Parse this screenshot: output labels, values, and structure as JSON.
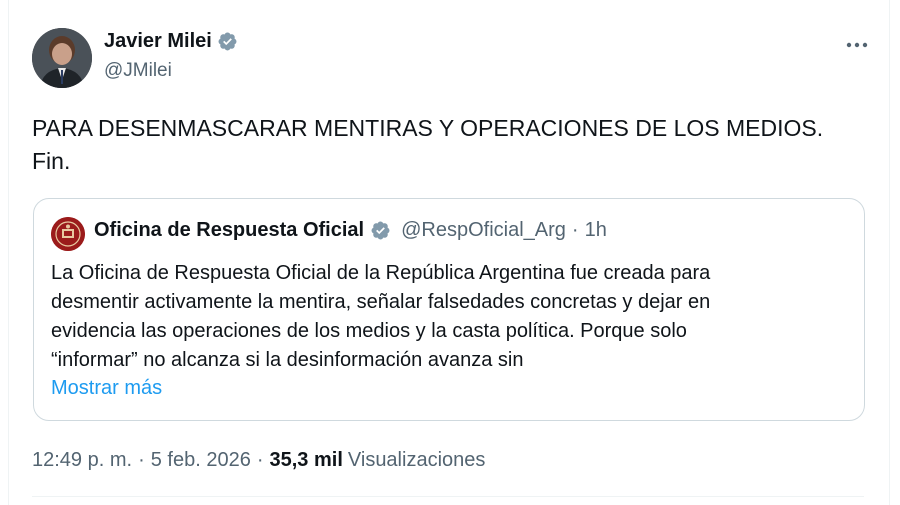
{
  "author": {
    "name": "Javier Milei",
    "handle": "@JMilei",
    "verified_icon": "verified-badge-icon",
    "avatar_icon": "profile-photo"
  },
  "more_icon": "more-options-icon",
  "tweet": {
    "line1": "PARA DESENMASCARAR MENTIRAS Y OPERACIONES DE LOS MEDIOS.",
    "line2": "Fin."
  },
  "quote": {
    "name": "Oficina de Respuesta Oficial",
    "handle": "@RespOficial_Arg",
    "separator": "·",
    "time": "1h",
    "lines": [
      "La Oficina de Respuesta Oficial de la República Argentina fue creada para",
      "desmentir activamente la mentira, señalar falsedades concretas y dejar en",
      "evidencia las operaciones de los medios y la casta política. Porque solo",
      "“informar” no alcanza si la desinformación avanza sin"
    ],
    "show_more": "Mostrar más"
  },
  "meta": {
    "time": "12:49 p. m.",
    "separator1": "·",
    "date": "5 feb. 2026",
    "separator2": "·",
    "views_count": "35,3 mil",
    "views_label": "Visualizaciones"
  },
  "colors": {
    "accent": "#1d9bf0",
    "verified": "#829aab",
    "secondary_text": "#536471",
    "border": "#cfd9de"
  }
}
